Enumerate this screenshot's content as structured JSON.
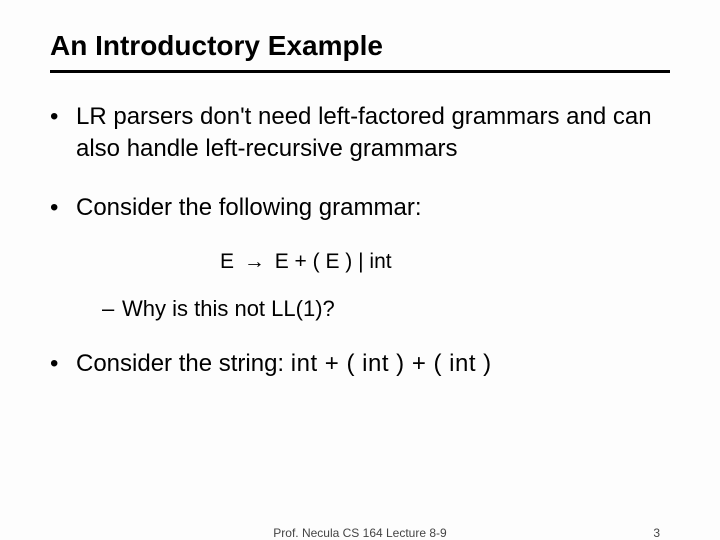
{
  "title": "An Introductory Example",
  "bullets": {
    "b1": "LR parsers don't need left-factored grammars and can also handle left-recursive grammars",
    "b2": "Consider the following grammar:",
    "grammar_lhs": "E",
    "grammar_rhs": "E + ( E )  |  int",
    "b3": "Why is this not LL(1)?",
    "b4_prefix": "Consider the string:  ",
    "b4_string": "int + ( int ) + ( int )"
  },
  "footer": {
    "center": "Prof. Necula  CS 164  Lecture 8-9",
    "page": "3"
  }
}
